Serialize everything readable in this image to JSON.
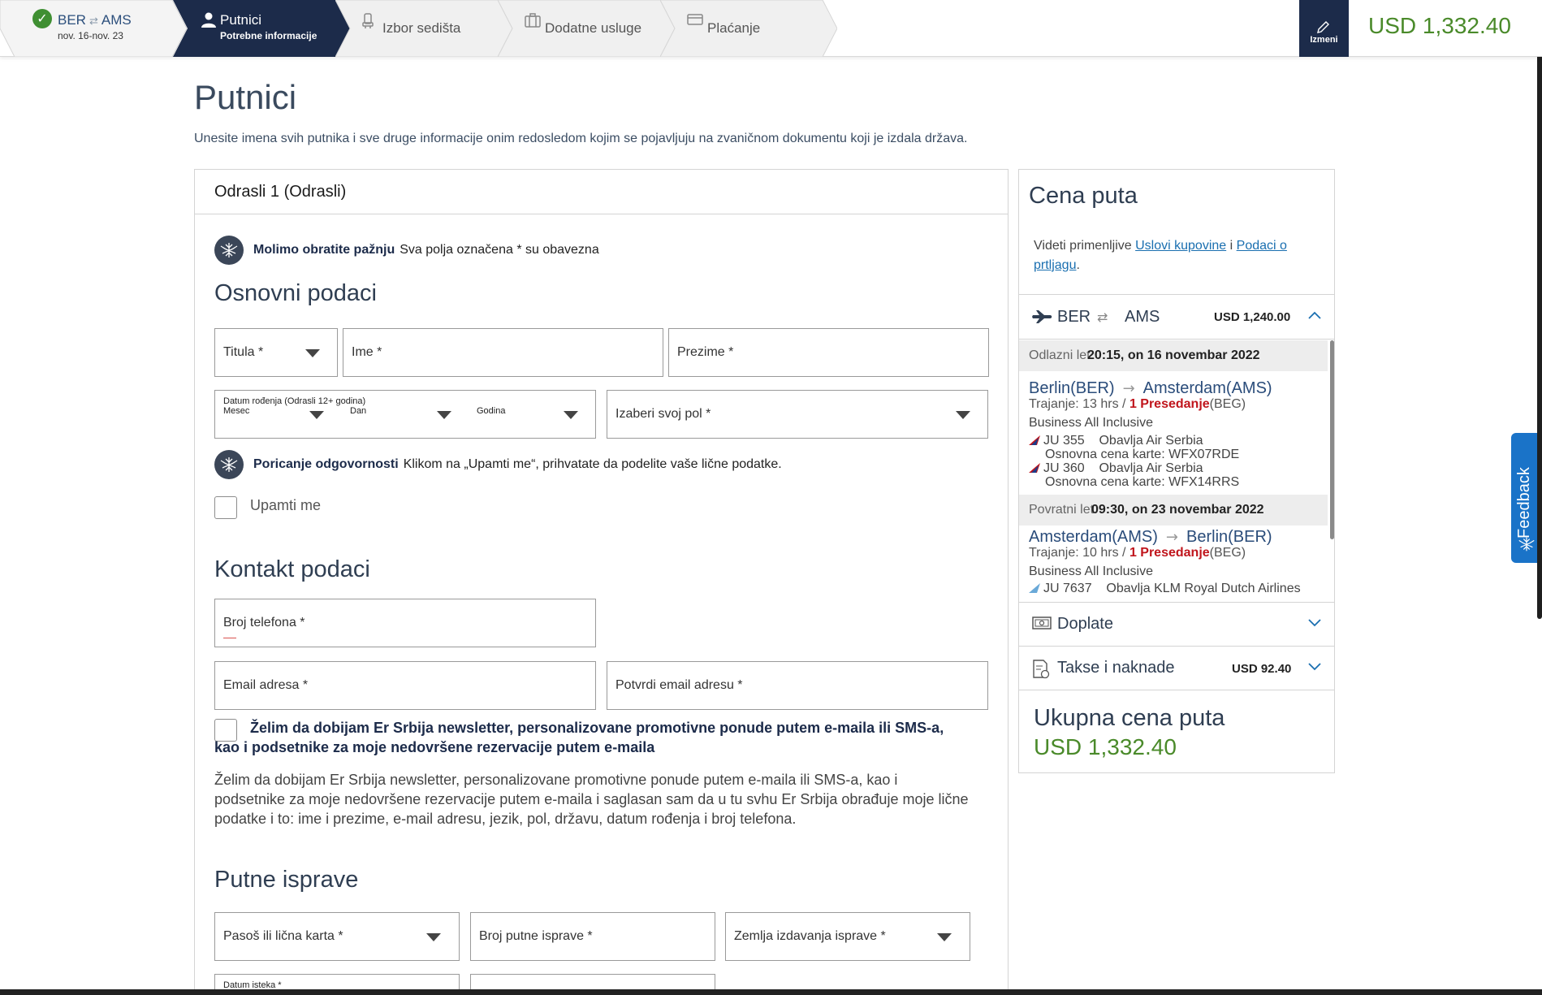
{
  "stepper": {
    "route_from": "BER",
    "route_to": "AMS",
    "route_swap": "⇄",
    "dates": "nov. 16-nov. 23",
    "active_title": "Putnici",
    "active_sub": "Potrebne informacije",
    "step3": "Izbor sedišta",
    "step4": "Dodatne usluge",
    "step5": "Plaćanje",
    "edit_label": "Izmeni",
    "total": "USD 1,332.40"
  },
  "page": {
    "title": "Putnici",
    "intro": "Unesite imena svih putnika i sve druge informacije onim redosledom kojim se pojavljuju na zvaničnom dokumentu koji je izdala država."
  },
  "form": {
    "card_title": "Odrasli 1 (Odrasli)",
    "notice1_bold": "Molimo obratite pažnju",
    "notice1_text": "Sva polja označena * su obavezna",
    "section_basic": "Osnovni podaci",
    "title_field": "Titula *",
    "first_name": "Ime *",
    "last_name": "Prezime *",
    "dob_label": "Datum rođenja (Odrasli 12+ godina)",
    "dob_month": "Mesec",
    "dob_day": "Dan",
    "dob_year": "Godina",
    "gender": "Izaberi svoj pol *",
    "notice2_bold": "Poricanje odgovornosti",
    "notice2_text": "Klikom na „Upamti me“, prihvatate da podelite vaše lične podatke.",
    "remember": "Upamti me",
    "section_contact": "Kontakt podaci",
    "phone": "Broj telefona *",
    "email": "Email adresa *",
    "email_confirm": "Potvrdi email adresu *",
    "newsletter_bold": "Želim da dobijam Er Srbija newsletter, personalizovane promotivne ponude putem e-maila ili SMS-a, kao i podsetnike za moje nedovršene rezervacije putem e-maila",
    "newsletter_text": "Želim da dobijam Er Srbija newsletter, personalizovane promotivne ponude putem e-maila ili SMS-a, kao i podsetnike za moje nedovršene rezervacije putem e-maila i saglasan sam da u tu svhu Er Srbija obrađuje moje lične podatke i to: ime i prezime, e-mail adresu, jezik, pol, državu, datum rođenja i broj telefona.",
    "section_docs": "Putne isprave",
    "doc_type": "Pasoš ili lična karta *",
    "doc_number": "Broj putne isprave *",
    "doc_country": "Zemlja izdavanja isprave *",
    "expiry_label": "Datum isteka *"
  },
  "sidebar": {
    "title": "Cena puta",
    "terms_prefix": "Videti primenljive",
    "terms_link1": "Uslovi kupovine",
    "terms_and": "i",
    "terms_link2": "Podaci o prtljagu",
    "terms_dot": ".",
    "route_from": "BER",
    "route_swap": "⇄",
    "route_to": "AMS",
    "route_amount": "USD 1,240.00",
    "outbound": {
      "label": "Odlazni let",
      "when": "20:15, on 16 novembar 2022",
      "from": "Berlin(BER)",
      "arrow": "→",
      "to": "Amsterdam(AMS)",
      "duration": "Trajanje: 13 hrs",
      "sep": "/",
      "stops": "1 Presedanje",
      "via": "(BEG)",
      "cabin": "Business All Inclusive",
      "flights": [
        {
          "no": "JU 355",
          "op": "Obavlja Air Serbia",
          "fare": "Osnovna cena karte: WFX07RDE"
        },
        {
          "no": "JU 360",
          "op": "Obavlja Air Serbia",
          "fare": "Osnovna cena karte: WFX14RRS"
        }
      ]
    },
    "inbound": {
      "label": "Povratni let",
      "when": "09:30, on 23 novembar 2022",
      "from": "Amsterdam(AMS)",
      "arrow": "→",
      "to": "Berlin(BER)",
      "duration": "Trajanje: 10 hrs",
      "sep": "/",
      "stops": "1 Presedanje",
      "via": "(BEG)",
      "cabin": "Business All Inclusive",
      "flight_no": "JU 7637",
      "flight_op": "Obavlja KLM Royal Dutch Airlines"
    },
    "surcharges": "Doplate",
    "taxes": "Takse i naknade",
    "taxes_amount": "USD 92.40",
    "total_label": "Ukupna cena puta",
    "total_value": "USD 1,332.40"
  },
  "feedback": "Feedback",
  "colors": {
    "navy": "#1c2b4a",
    "green": "#4a8a2a",
    "red": "#c0151c",
    "link": "#1a6fb0",
    "feedback_blue": "#1a73c8"
  }
}
